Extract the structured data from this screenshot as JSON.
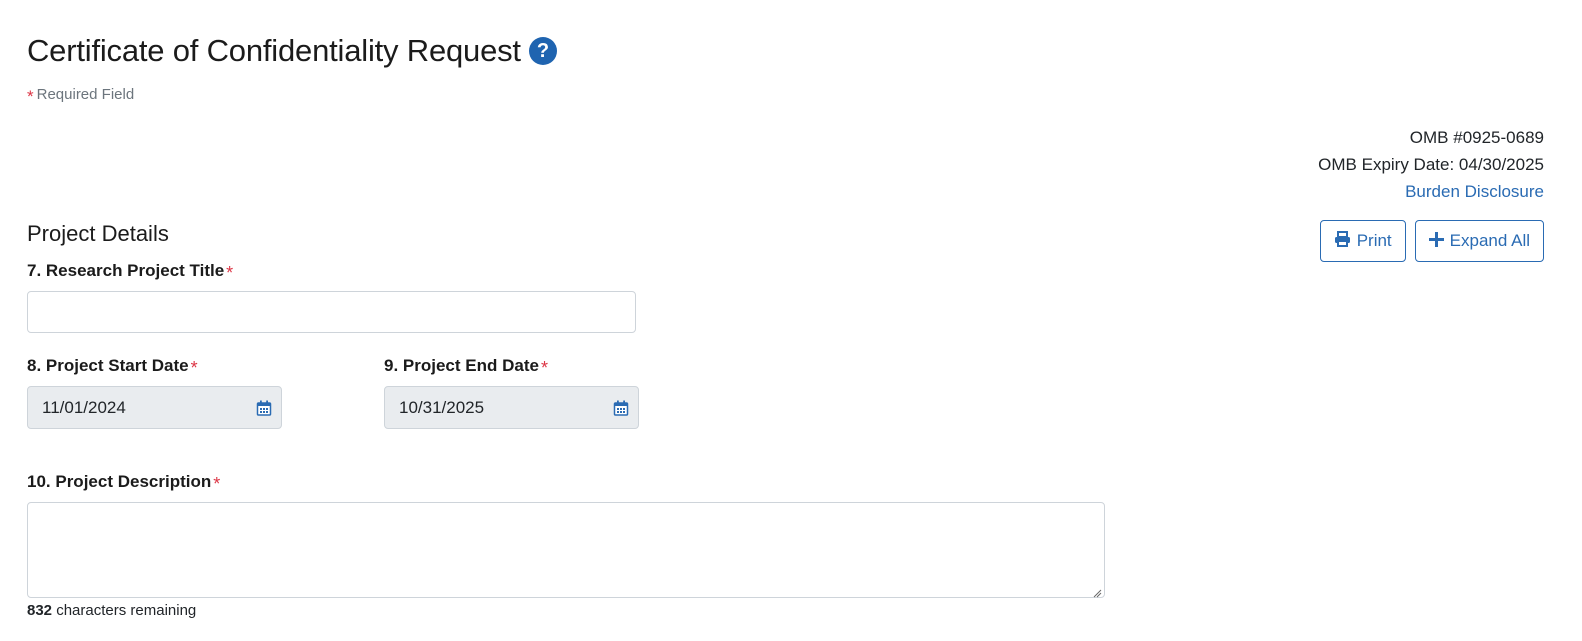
{
  "header": {
    "title": "Certificate of Confidentiality Request",
    "help_icon": "question-circle-icon",
    "required_marker": "*",
    "required_note": "Required Field"
  },
  "omb": {
    "number": "OMB #0925-0689",
    "expiry": "OMB Expiry Date: 04/30/2025",
    "burden_link": "Burden Disclosure"
  },
  "toolbar": {
    "print_label": "Print",
    "print_icon": "print-icon",
    "expand_label": "Expand All",
    "expand_icon": "plus-icon"
  },
  "section": {
    "title": "Project Details"
  },
  "fields": {
    "title": {
      "label": "7. Research Project Title",
      "value": "",
      "required": true
    },
    "start_date": {
      "label": "8. Project Start Date",
      "value": "11/01/2024",
      "icon": "calendar-icon",
      "required": true
    },
    "end_date": {
      "label": "9. Project End Date",
      "value": "10/31/2025",
      "icon": "calendar-icon",
      "required": true
    },
    "description": {
      "label": "10. Project Description",
      "value": "",
      "required": true,
      "remaining_count": "832",
      "remaining_text": "characters remaining"
    }
  },
  "colors": {
    "accent": "#2a6bb3",
    "required": "#dc3545",
    "disabled_bg": "#e9ecef"
  }
}
